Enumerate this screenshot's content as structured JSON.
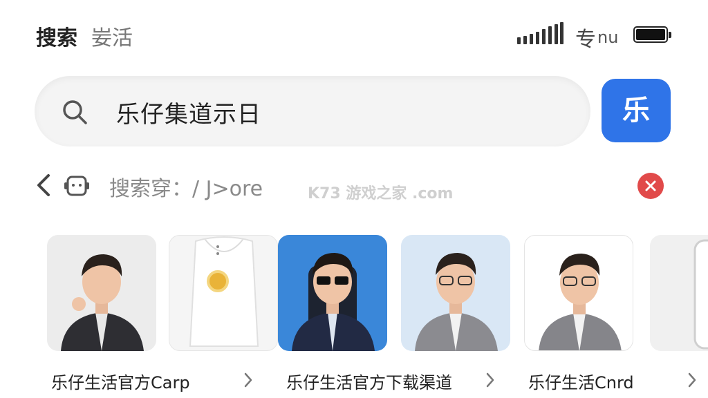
{
  "status_bar": {
    "title_left": "搜索",
    "title_right": "妛活",
    "carrier_cn": "专",
    "carrier_suffix": "nu"
  },
  "search": {
    "query": "乐仔集道示日",
    "app_badge": "乐"
  },
  "filter": {
    "label": "搜索穿：/ J>ore",
    "watermark": "K73 游戏之家 .com"
  },
  "results": [
    {
      "caption": "乐仔生活官方Carp"
    },
    {
      "caption": "乐仔生活官方下载渠道"
    },
    {
      "caption": "乐仔生活Cnrd"
    }
  ],
  "colors": {
    "accent_blue": "#2f74e8",
    "clear_red": "#e14a4a",
    "search_bg": "#f4f4f4"
  }
}
